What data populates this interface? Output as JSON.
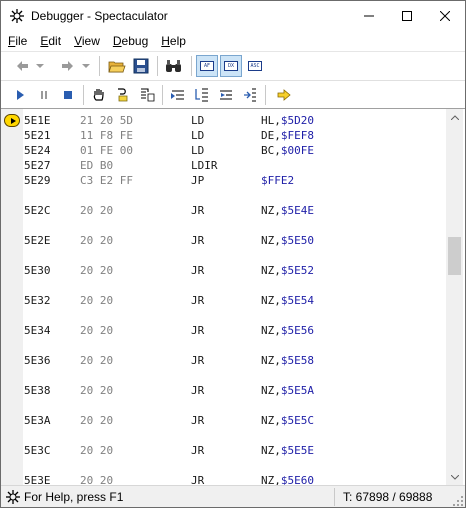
{
  "window": {
    "title": "Debugger - Spectaculator"
  },
  "menu": [
    {
      "label": "File",
      "accel": "F",
      "rest": "ile"
    },
    {
      "label": "Edit",
      "accel": "E",
      "rest": "dit"
    },
    {
      "label": "View",
      "accel": "V",
      "rest": "iew"
    },
    {
      "label": "Debug",
      "accel": "D",
      "rest": "ebug"
    },
    {
      "label": "Help",
      "accel": "H",
      "rest": "elp"
    }
  ],
  "toolbar1": {
    "icons": [
      "back-icon",
      "back-dropdown-icon",
      "forward-icon",
      "forward-dropdown-icon",
      "open-folder-icon",
      "save-icon",
      "find-icon",
      "registers-af-icon",
      "registers-dx-icon",
      "registers-asc-icon"
    ],
    "reg_af": "AF",
    "reg_dx": "DX",
    "reg_asc": "ASC"
  },
  "toolbar2": {
    "icons": [
      "run-icon",
      "pause-icon",
      "stop-icon",
      "hand-icon",
      "step-into-icon",
      "step-over-icon",
      "run-to-cursor-icon",
      "step-out-icon",
      "toggle-breakpoint-icon",
      "trace-icon",
      "jump-to-pc-icon"
    ]
  },
  "disassembly": [
    {
      "addr": "5E1E",
      "bytes": "21 20 5D",
      "mnem": "LD",
      "reg": "HL,",
      "val": "$5D20",
      "pc": true
    },
    {
      "addr": "5E21",
      "bytes": "11 F8 FE",
      "mnem": "LD",
      "reg": "DE,",
      "val": "$FEF8"
    },
    {
      "addr": "5E24",
      "bytes": "01 FE 00",
      "mnem": "LD",
      "reg": "BC,",
      "val": "$00FE"
    },
    {
      "addr": "5E27",
      "bytes": "ED B0",
      "mnem": "LDIR",
      "reg": "",
      "val": ""
    },
    {
      "addr": "5E29",
      "bytes": "C3 E2 FF",
      "mnem": "JP",
      "reg": "",
      "val": "$FFE2"
    },
    {
      "addr": "5E2C",
      "bytes": "20 20",
      "mnem": "JR",
      "reg": "NZ,",
      "val": "$5E4E"
    },
    {
      "addr": "5E2E",
      "bytes": "20 20",
      "mnem": "JR",
      "reg": "NZ,",
      "val": "$5E50"
    },
    {
      "addr": "5E30",
      "bytes": "20 20",
      "mnem": "JR",
      "reg": "NZ,",
      "val": "$5E52"
    },
    {
      "addr": "5E32",
      "bytes": "20 20",
      "mnem": "JR",
      "reg": "NZ,",
      "val": "$5E54"
    },
    {
      "addr": "5E34",
      "bytes": "20 20",
      "mnem": "JR",
      "reg": "NZ,",
      "val": "$5E56"
    },
    {
      "addr": "5E36",
      "bytes": "20 20",
      "mnem": "JR",
      "reg": "NZ,",
      "val": "$5E58"
    },
    {
      "addr": "5E38",
      "bytes": "20 20",
      "mnem": "JR",
      "reg": "NZ,",
      "val": "$5E5A"
    },
    {
      "addr": "5E3A",
      "bytes": "20 20",
      "mnem": "JR",
      "reg": "NZ,",
      "val": "$5E5C"
    },
    {
      "addr": "5E3C",
      "bytes": "20 20",
      "mnem": "JR",
      "reg": "NZ,",
      "val": "$5E5E"
    },
    {
      "addr": "5E3E",
      "bytes": "20 20",
      "mnem": "JR",
      "reg": "NZ,",
      "val": "$5E60"
    }
  ],
  "status": {
    "help": "For Help, press F1",
    "tstates": "T: 67898 / 69888"
  },
  "colors": {
    "operand_value": "#2020a8",
    "bytes": "#808080",
    "pc_marker": "#ffd700",
    "pressed_button": "#cce4f7"
  }
}
